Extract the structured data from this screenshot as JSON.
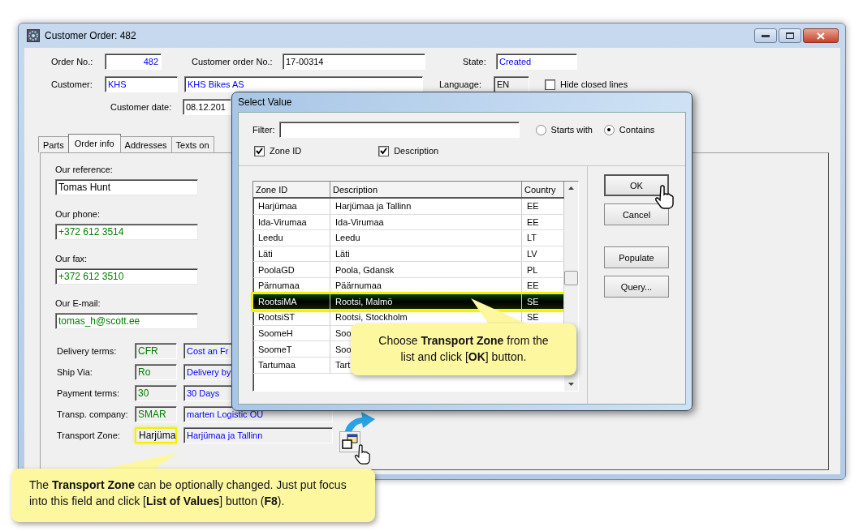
{
  "window": {
    "title": "Customer Order: 482"
  },
  "header": {
    "order_no": {
      "label": "Order No.:",
      "value": "482"
    },
    "customer_order_no": {
      "label": "Customer order No.:",
      "value": "17-00314"
    },
    "state": {
      "label": "State:",
      "value": "Created"
    },
    "customer": {
      "label": "Customer:",
      "code": "KHS",
      "name": "KHS Bikes AS"
    },
    "language": {
      "label": "Language:",
      "value": "EN"
    },
    "hide_closed_lines": {
      "label": "Hide closed lines",
      "checked": false
    },
    "customer_date": {
      "label": "Customer date:",
      "value": "08.12.201"
    }
  },
  "tabs": [
    {
      "label": "Parts",
      "selected": false
    },
    {
      "label": "Order info",
      "selected": true
    },
    {
      "label": "Addresses",
      "selected": false
    },
    {
      "label": "Texts on",
      "selected": false
    }
  ],
  "contact_fields": [
    {
      "label": "Our reference:",
      "value": "Tomas Hunt",
      "color": "#000000"
    },
    {
      "label": "Our phone:",
      "value": "+372 612 3514",
      "color": "#008000"
    },
    {
      "label": "Our fax:",
      "value": "+372 612 3510",
      "color": "#008000"
    },
    {
      "label": "Our E-mail:",
      "value": "tomas_h@scott.ee",
      "color": "#008000"
    }
  ],
  "terms": [
    {
      "label": "Delivery terms:",
      "code": "CFR",
      "color": "#008000",
      "description": "Cost an Fr",
      "focused": false
    },
    {
      "label": "Ship Via:",
      "code": "Ro",
      "color": "#008000",
      "description": "Delivery by",
      "focused": false
    },
    {
      "label": "Payment terms:",
      "code": "30",
      "color": "#008000",
      "description": "30 Days",
      "focused": false
    },
    {
      "label": "Transp. company:",
      "code": "SMAR",
      "color": "#008000",
      "description": "marten Logistic OÜ",
      "focused": false
    },
    {
      "label": "Transport Zone:",
      "code": "Harjüma",
      "color": "#000000",
      "description": "Harjümaa ja Tallinn",
      "focused": true
    }
  ],
  "dialog": {
    "title": "Select Value",
    "filter": {
      "label": "Filter:"
    },
    "match_options": [
      {
        "label": "Starts with",
        "selected": false
      },
      {
        "label": "Contains",
        "selected": true
      }
    ],
    "search_columns": [
      {
        "label": "Zone ID",
        "checked": true
      },
      {
        "label": "Description",
        "checked": true
      }
    ],
    "columns": [
      "Zone ID",
      "Description",
      "Country"
    ],
    "rows": [
      {
        "zone_id": "Harjümaa",
        "description": "Harjümaa ja Tallinn",
        "country": "EE",
        "selected": false
      },
      {
        "zone_id": "Ida-Virumaa",
        "description": "Ida-Virumaa",
        "country": "EE",
        "selected": false
      },
      {
        "zone_id": "Leedu",
        "description": "Leedu",
        "country": "LT",
        "selected": false
      },
      {
        "zone_id": "Läti",
        "description": "Läti",
        "country": "LV",
        "selected": false
      },
      {
        "zone_id": "PoolaGD",
        "description": "Poola, Gdansk",
        "country": "PL",
        "selected": false
      },
      {
        "zone_id": "Pärnumaa",
        "description": "Päärnumaa",
        "country": "EE",
        "selected": false
      },
      {
        "zone_id": "RootsiMA",
        "description": "Rootsi, Malmö",
        "country": "SE",
        "selected": true
      },
      {
        "zone_id": "RootsiST",
        "description": "Rootsi, Stockholm",
        "country": "SE",
        "selected": false
      },
      {
        "zone_id": "SoomeH",
        "description": "Soo",
        "selected": false
      },
      {
        "zone_id": "SoomeT",
        "description": "Soo",
        "selected": false
      },
      {
        "zone_id": "Tartumaa",
        "description": "Tart",
        "selected": false
      }
    ],
    "buttons": [
      {
        "label": "OK",
        "default": true
      },
      {
        "label": "Cancel",
        "default": false
      },
      {
        "label": "Populate",
        "default": false
      },
      {
        "label": "Query...",
        "default": false
      }
    ]
  },
  "callouts": [
    {
      "text": "Choose **Transport Zone** from the list and click [**OK**] button."
    },
    {
      "text": "The **Transport Zone** can be optionally changed.  Just put focus into this field and click [**List of Values**] button (**F8**)."
    }
  ]
}
